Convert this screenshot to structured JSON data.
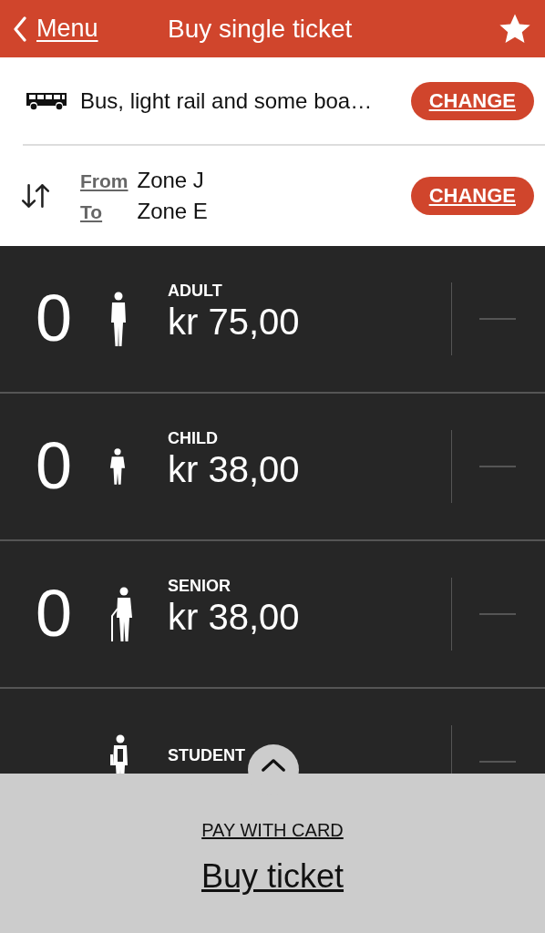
{
  "header": {
    "back_label": "Menu",
    "title": "Buy single ticket"
  },
  "mode": {
    "text": "Bus, light rail and some boa…",
    "button": "CHANGE"
  },
  "zones": {
    "from_label": "From",
    "from_value": "Zone J",
    "to_label": "To",
    "to_value": "Zone E",
    "button": "CHANGE"
  },
  "travellers": [
    {
      "kind": "adult",
      "label": "ADULT",
      "count": "0",
      "price": "kr 75,00"
    },
    {
      "kind": "child",
      "label": "CHILD",
      "count": "0",
      "price": "kr 38,00"
    },
    {
      "kind": "senior",
      "label": "SENIOR",
      "count": "0",
      "price": "kr 38,00"
    },
    {
      "kind": "student",
      "label": "STUDENT"
    }
  ],
  "payment": {
    "method": "PAY WITH CARD",
    "button": "Buy ticket"
  }
}
